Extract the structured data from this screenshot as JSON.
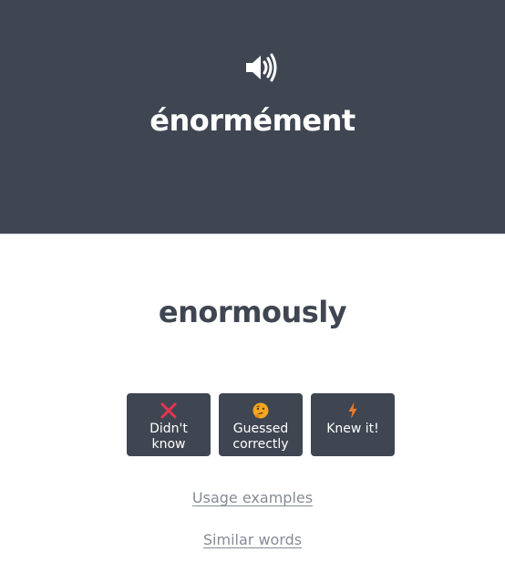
{
  "card": {
    "word": "énormément",
    "translation": "enormously",
    "speaker_icon": "speaker-volume-icon"
  },
  "answers": [
    {
      "label": "Didn't know",
      "icon": "cross-icon",
      "icon_color": "#e8334e"
    },
    {
      "label": "Guessed correctly",
      "icon": "thinking-face-icon",
      "icon_color": "#f5a623"
    },
    {
      "label": "Knew it!",
      "icon": "lightning-icon",
      "icon_color": "#f07c2a"
    }
  ],
  "links": {
    "usage_examples": "Usage examples",
    "similar_words": "Similar words"
  },
  "colors": {
    "card_bg": "#3f4652",
    "button_bg": "#3f4652",
    "link": "#858b96"
  }
}
